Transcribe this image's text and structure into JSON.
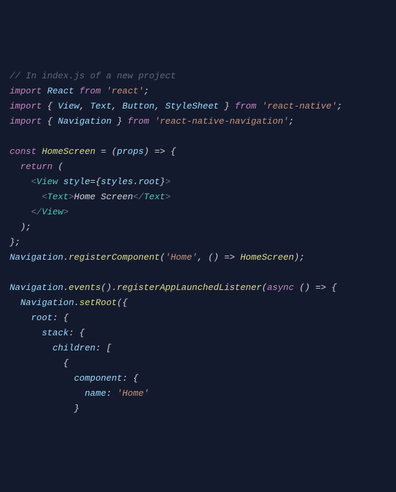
{
  "code": {
    "line1_comment": "// In index.js of a new project",
    "line2": {
      "import": "import",
      "react": "React",
      "from": "from",
      "mod": "'react'",
      "semi": ";"
    },
    "line3": {
      "import": "import",
      "lb": "{ ",
      "view": "View",
      "c1": ", ",
      "text": "Text",
      "c2": ", ",
      "button": "Button",
      "c3": ", ",
      "stylesheet": "StyleSheet",
      "rb": " }",
      "from": "from",
      "mod": "'react-native'",
      "semi": ";"
    },
    "line4": {
      "import": "import",
      "lb": "{ ",
      "nav": "Navigation",
      "rb": " }",
      "from": "from",
      "mod": "'react-native-navigation'",
      "semi": ";"
    },
    "line6": {
      "const": "const",
      "name": "HomeScreen",
      "eq": " = (",
      "props": "props",
      "arrow": ") => {"
    },
    "line7": {
      "return": "return",
      "open": " ("
    },
    "line8": {
      "o": "<",
      "tag": "View",
      "sp": " ",
      "attr": "style",
      "eq": "=",
      "lb": "{",
      "obj": "styles",
      "dot": ".",
      "prop": "root",
      "rb": "}",
      "c": ">"
    },
    "line9": {
      "o": "<",
      "tag": "Text",
      "c": ">",
      "txt": "Home Screen",
      "o2": "</",
      "tag2": "Text",
      "c2": ">"
    },
    "line10": {
      "o": "</",
      "tag": "View",
      "c": ">"
    },
    "line11": "  );",
    "line12": "};",
    "line13": {
      "nav": "Navigation",
      "dot": ".",
      "fn": "registerComponent",
      "open": "(",
      "str": "'Home'",
      "c1": ", () => ",
      "hs": "HomeScreen",
      "close": ");"
    },
    "line15": {
      "nav": "Navigation",
      "dot": ".",
      "fn1": "events",
      "p1": "().",
      "fn2": "registerAppLaunchedListener",
      "open": "(",
      "async": "async",
      "arrow": " () => {"
    },
    "line16": {
      "nav": "Navigation",
      "dot": ".",
      "fn": "setRoot",
      "open": "({"
    },
    "line17": {
      "prop": "root",
      "rest": ": {"
    },
    "line18": {
      "prop": "stack",
      "rest": ": {"
    },
    "line19": {
      "prop": "children",
      "rest": ": ["
    },
    "line20": "          {",
    "line21": {
      "prop": "component",
      "rest": ": {"
    },
    "line22": {
      "prop": "name",
      "rest": ": ",
      "str": "'Home'"
    },
    "line23": "            }"
  }
}
